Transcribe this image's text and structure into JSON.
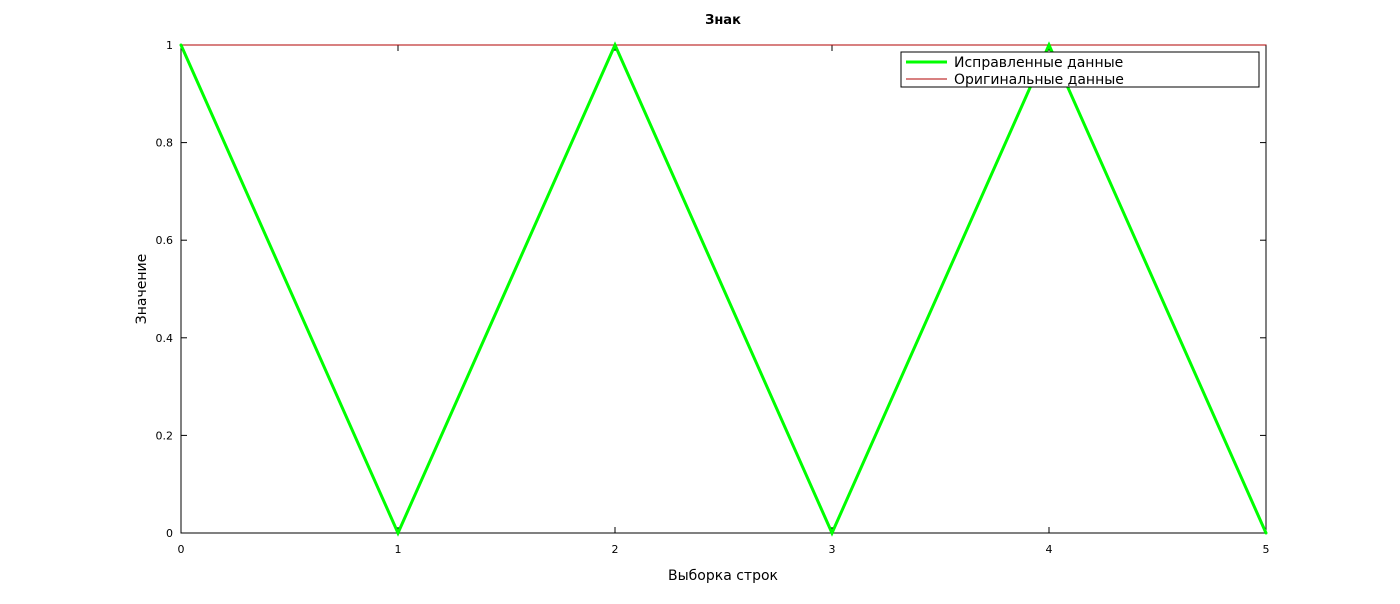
{
  "chart_data": {
    "type": "line",
    "title": "Знак",
    "xlabel": "Выборка строк",
    "ylabel": "Значение",
    "xlim": [
      0,
      5
    ],
    "ylim": [
      0,
      1
    ],
    "x_ticks": [
      "0",
      "1",
      "2",
      "3",
      "4",
      "5"
    ],
    "y_ticks": [
      "0",
      "0.2",
      "0.4",
      "0.6",
      "0.8",
      "1"
    ],
    "x_tick_values": [
      0,
      1,
      2,
      3,
      4,
      5
    ],
    "y_tick_values": [
      0,
      0.2,
      0.4,
      0.6,
      0.8,
      1
    ],
    "grid": false,
    "legend_position": "top-right",
    "x": [
      0,
      1,
      2,
      3,
      4,
      5
    ],
    "series": [
      {
        "name": "Исправленные данные",
        "values": [
          1,
          0,
          1,
          0,
          1,
          0
        ],
        "color": "#00ff00"
      },
      {
        "name": "Оригинальные данные",
        "values": [
          1,
          1,
          1,
          1,
          1,
          1
        ],
        "color": "#b00000"
      }
    ]
  }
}
